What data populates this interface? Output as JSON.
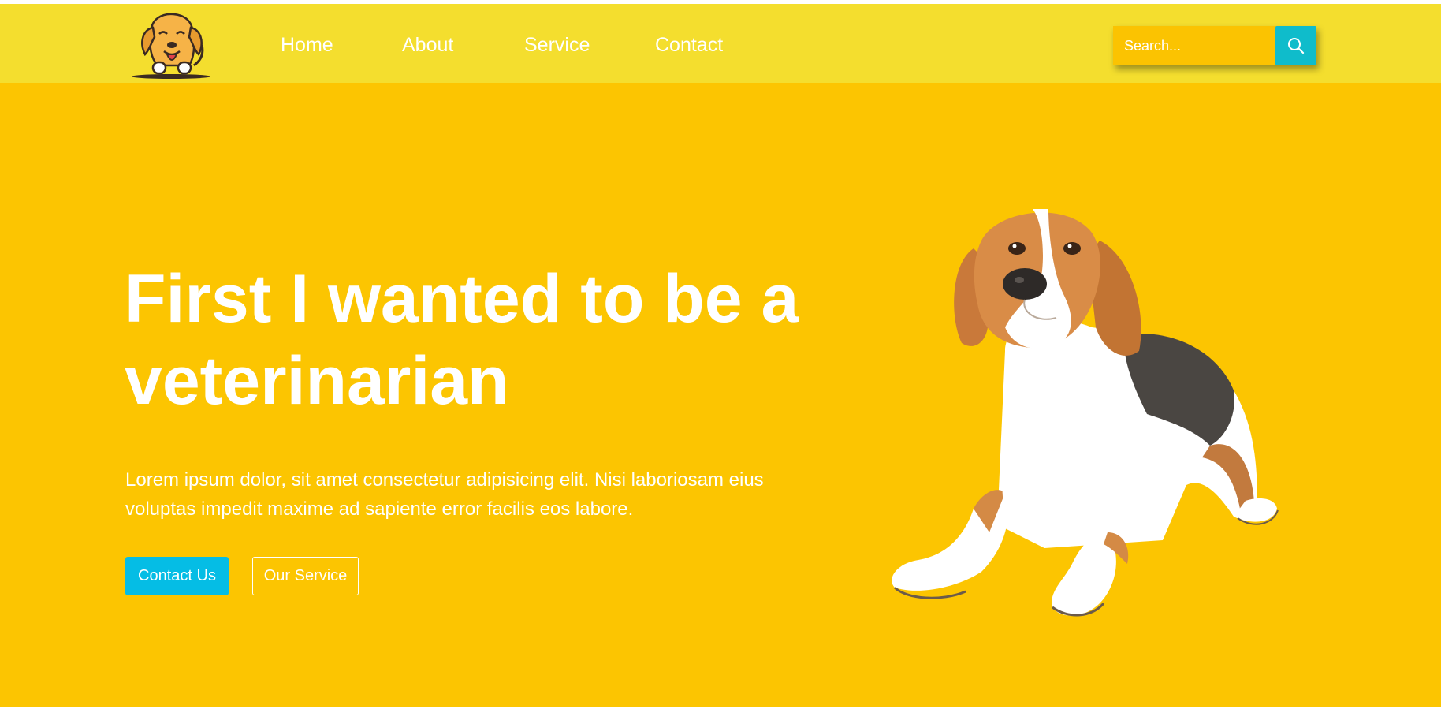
{
  "nav": {
    "links": [
      {
        "label": "Home"
      },
      {
        "label": "About"
      },
      {
        "label": "Service"
      },
      {
        "label": "Contact"
      }
    ],
    "search": {
      "placeholder": "Search..."
    }
  },
  "hero": {
    "title": "First I wanted to be a veterinarian",
    "text": "Lorem ipsum dolor, sit amet consectetur adipisicing elit. Nisi laboriosam eius voluptas impedit maxime ad sapiente error facilis eos labore.",
    "contact_label": "Contact Us",
    "service_label": "Our Service"
  },
  "icons": {
    "logo": "dog-logo-icon",
    "search": "search-icon",
    "hero_image": "beagle-image"
  },
  "colors": {
    "navbar_bg": "#f4de2e",
    "hero_bg": "#fcc501",
    "search_input_bg": "#fbc301",
    "search_button_bg": "#0fbccb",
    "contact_button_bg": "#05bde5",
    "text": "#ffffff"
  }
}
